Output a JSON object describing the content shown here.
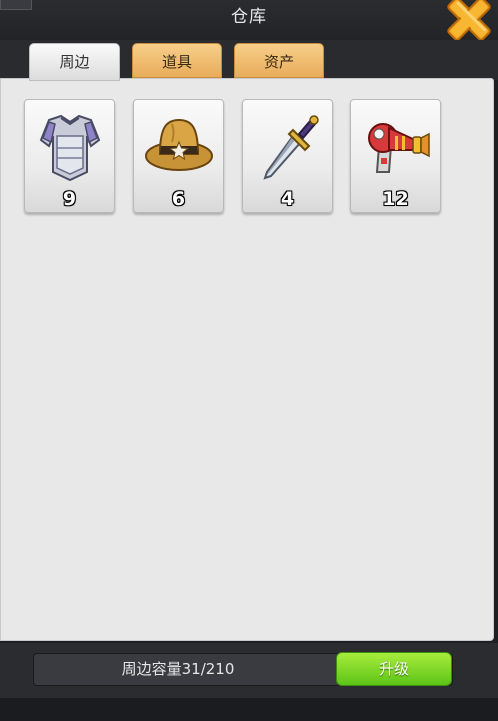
{
  "window": {
    "title": "仓库"
  },
  "tabs": [
    {
      "label": "周边",
      "active": true
    },
    {
      "label": "道具",
      "active": false
    },
    {
      "label": "资产",
      "active": false
    }
  ],
  "items": [
    {
      "icon": "armor-icon",
      "count": "9"
    },
    {
      "icon": "cowboy-hat-icon",
      "count": "6"
    },
    {
      "icon": "dagger-icon",
      "count": "4"
    },
    {
      "icon": "ray-gun-icon",
      "count": "12"
    }
  ],
  "footer": {
    "capacity_text": "周边容量31/210",
    "upgrade_label": "升级"
  },
  "colors": {
    "active_tab": "#f0f0f0",
    "inactive_tab": "#f2c27a",
    "upgrade_button": "#7bd52a",
    "close_icon": "#f5a623"
  }
}
